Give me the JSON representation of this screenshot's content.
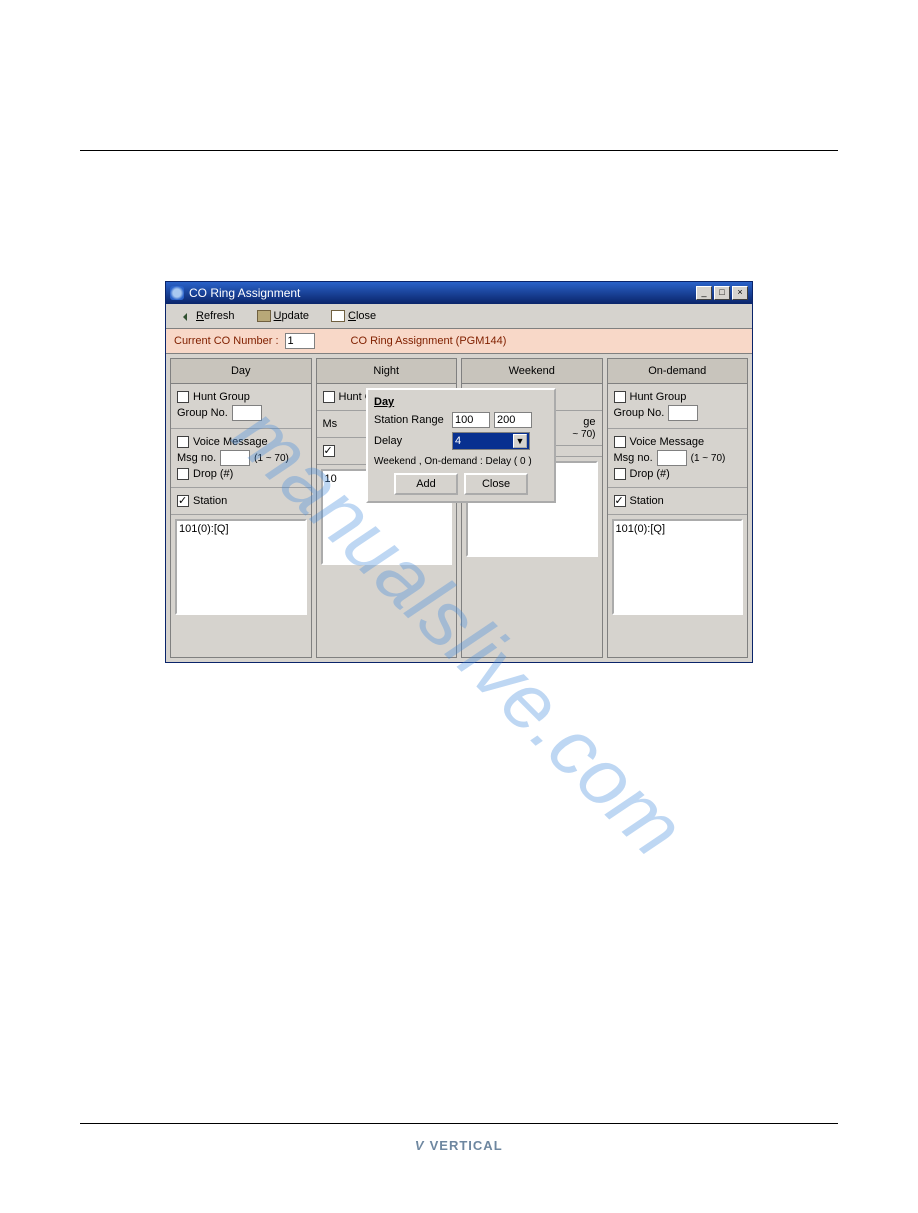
{
  "watermark": "manualslive.com",
  "footer_logo": "VERTICAL",
  "window": {
    "title": "CO Ring Assignment",
    "toolbar": {
      "refresh": "Refresh",
      "update": "Update",
      "close": "Close"
    },
    "co_row": {
      "label": "Current CO Number :",
      "value": "1",
      "pgm": "CO Ring Assignment (PGM144)"
    },
    "headers": [
      "Day",
      "Night",
      "Weekend",
      "On-demand"
    ],
    "labels": {
      "hunt_group": "Hunt Group",
      "group_no": "Group No.",
      "voice_msg": "Voice Message",
      "msg_no": "Msg no.",
      "msg_hint": "(1 ~ 70)",
      "msg_hint_short": "~ 70)",
      "drop": "Drop (#)",
      "station": "Station"
    },
    "station_list": "101(0):[Q]"
  },
  "popup": {
    "title": "Day",
    "range_label": "Station Range",
    "range_from": "100",
    "range_to": "200",
    "delay_label": "Delay",
    "delay_value": "4",
    "note": "Weekend , On-demand : Delay ( 0 )",
    "add": "Add",
    "close": "Close"
  }
}
